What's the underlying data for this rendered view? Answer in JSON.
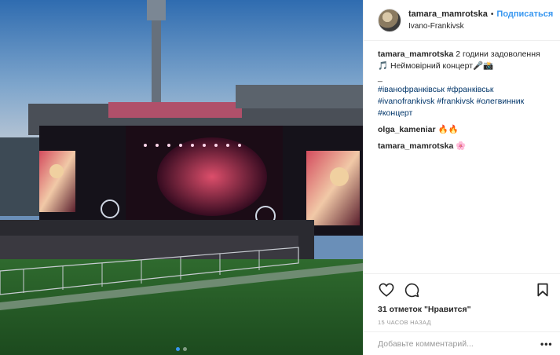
{
  "post": {
    "username": "tamara_mamrotska",
    "separator": "•",
    "follow_label": "Подписаться",
    "location": "Ivano-Frankivsk"
  },
  "caption": {
    "username": "tamara_mamrotska",
    "text": "2 години задоволення 🎵 Неймовірний концерт🎤📸",
    "dash": "_",
    "hashtags": [
      "#іванофранківськ",
      "#франківськ",
      "#ivanofrankivsk",
      "#frankivsk",
      "#олегвинник",
      "#концерт"
    ]
  },
  "comments": [
    {
      "user": "olga_kameniar",
      "text": "🔥🔥"
    },
    {
      "user": "tamara_mamrotska",
      "text": "🌸"
    }
  ],
  "stats": {
    "likes_text": "31 отметок \"Нравится\"",
    "time_text": "15 часов назад"
  },
  "comment_box": {
    "placeholder": "Добавьте комментарий...",
    "more": "•••"
  },
  "icons": {
    "like": "heart-icon",
    "comment": "comment-bubble-icon",
    "save": "bookmark-icon",
    "more": "more-options-icon"
  },
  "carousel": {
    "count": 2,
    "active": 1
  },
  "colors": {
    "accent": "#3897f0",
    "hashtag": "#003569",
    "muted": "#999999"
  }
}
